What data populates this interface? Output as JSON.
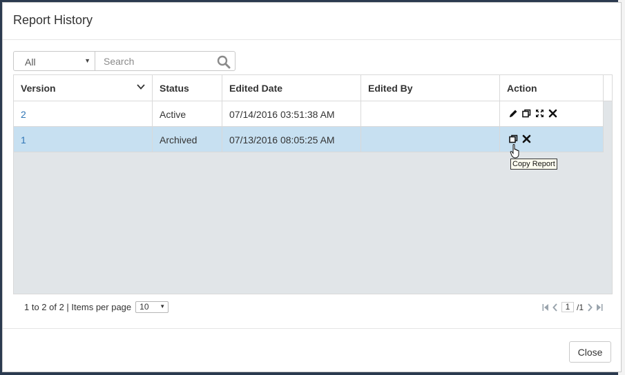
{
  "dialog": {
    "title": "Report History"
  },
  "filter": {
    "selected": "All",
    "search_placeholder": "Search"
  },
  "table": {
    "columns": [
      "Version",
      "Status",
      "Edited Date",
      "Edited By",
      "Action"
    ],
    "rows": [
      {
        "version": "2",
        "status": "Active",
        "edited_date": "07/14/2016 03:51:38 AM",
        "edited_by": "",
        "actions": [
          "edit-icon",
          "copy-icon",
          "expand-icon",
          "delete-icon"
        ]
      },
      {
        "version": "1",
        "status": "Archived",
        "edited_date": "07/13/2016 08:05:25 AM",
        "edited_by": "",
        "actions": [
          "copy-icon",
          "delete-icon"
        ]
      }
    ]
  },
  "tooltip": "Copy Report",
  "pager": {
    "summary": "1 to 2 of 2 | Items per page",
    "items_per_page": "10",
    "current_page": "1",
    "total_pages": "/1"
  },
  "footer": {
    "close_label": "Close"
  },
  "colors": {
    "link": "#2f75b5",
    "selected_row": "#c7e0f1",
    "grid_bg": "#e1e5e8",
    "backdrop": "#2b3a4f"
  }
}
